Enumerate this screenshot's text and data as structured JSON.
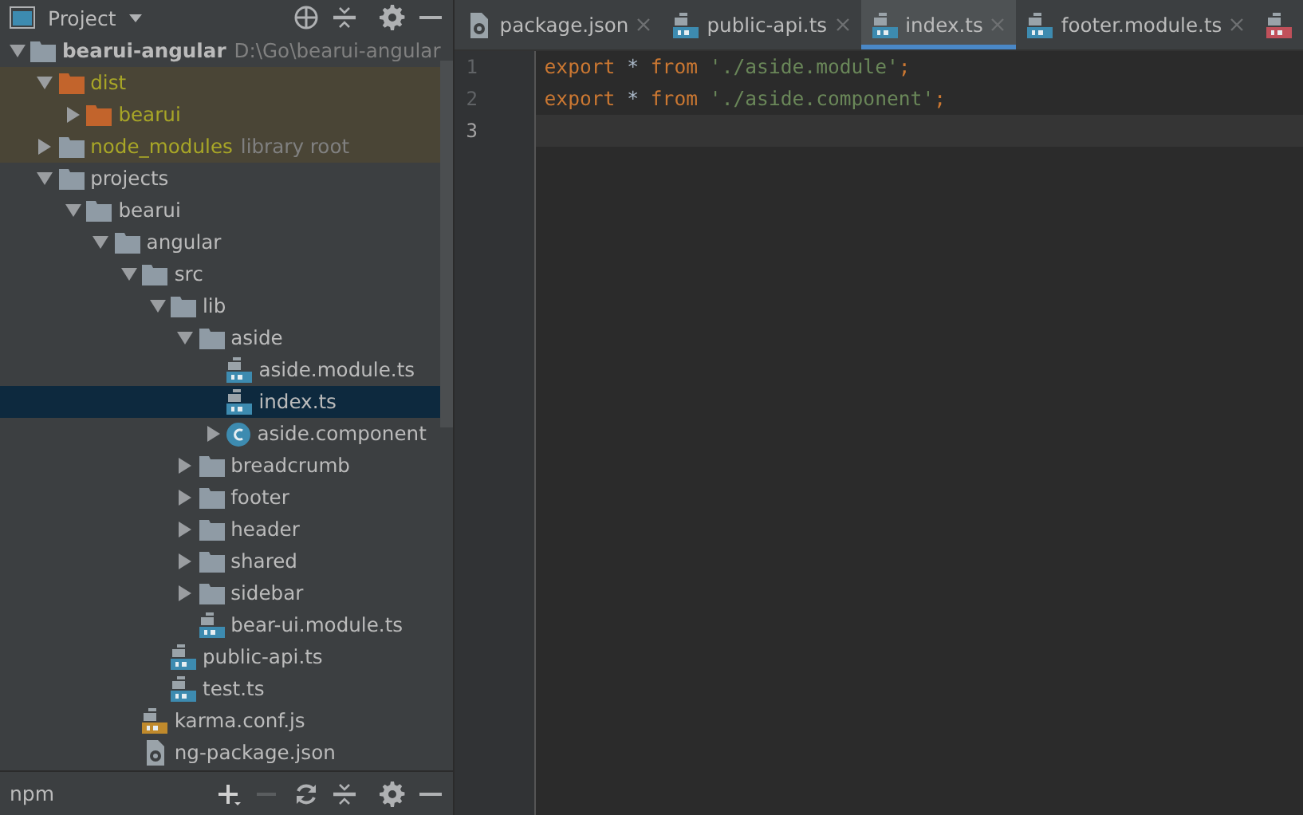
{
  "project_panel": {
    "title": "Project",
    "tree": [
      {
        "name": "bearui-angular",
        "kind": "folder",
        "expanded": true,
        "selected": false,
        "hint": "D:\\Go\\bearui-angular",
        "children": [
          {
            "name": "dist",
            "kind": "excluded_folder",
            "expanded": true,
            "selected": false,
            "children": [
              {
                "name": "bearui",
                "kind": "excluded_folder",
                "expanded": false,
                "selected": false
              }
            ]
          },
          {
            "name": "node_modules",
            "kind": "library_folder",
            "expanded": false,
            "selected": false,
            "hint": "library root"
          },
          {
            "name": "projects",
            "kind": "folder",
            "expanded": true,
            "selected": false,
            "children": [
              {
                "name": "bearui",
                "kind": "folder",
                "expanded": true,
                "selected": false,
                "children": [
                  {
                    "name": "angular",
                    "kind": "folder",
                    "expanded": true,
                    "selected": false,
                    "children": [
                      {
                        "name": "src",
                        "kind": "folder",
                        "expanded": true,
                        "selected": false,
                        "children": [
                          {
                            "name": "lib",
                            "kind": "folder",
                            "expanded": true,
                            "selected": false,
                            "children": [
                              {
                                "name": "aside",
                                "kind": "folder",
                                "expanded": true,
                                "selected": false,
                                "children": [
                                  {
                                    "name": "aside.module.ts",
                                    "kind": "ts",
                                    "selected": false
                                  },
                                  {
                                    "name": "index.ts",
                                    "kind": "ts",
                                    "selected": true
                                  },
                                  {
                                    "name": "aside.component",
                                    "kind": "component",
                                    "expanded": false,
                                    "selected": false
                                  }
                                ]
                              },
                              {
                                "name": "breadcrumb",
                                "kind": "folder",
                                "expanded": false,
                                "selected": false
                              },
                              {
                                "name": "footer",
                                "kind": "folder",
                                "expanded": false,
                                "selected": false
                              },
                              {
                                "name": "header",
                                "kind": "folder",
                                "expanded": false,
                                "selected": false
                              },
                              {
                                "name": "shared",
                                "kind": "folder",
                                "expanded": false,
                                "selected": false
                              },
                              {
                                "name": "sidebar",
                                "kind": "folder",
                                "expanded": false,
                                "selected": false
                              },
                              {
                                "name": "bear-ui.module.ts",
                                "kind": "ts",
                                "selected": false
                              }
                            ]
                          },
                          {
                            "name": "public-api.ts",
                            "kind": "ts",
                            "selected": false
                          },
                          {
                            "name": "test.ts",
                            "kind": "ts",
                            "selected": false
                          }
                        ]
                      },
                      {
                        "name": "karma.conf.js",
                        "kind": "js",
                        "selected": false
                      },
                      {
                        "name": "ng-package.json",
                        "kind": "json",
                        "selected": false
                      }
                    ]
                  }
                ]
              }
            ]
          }
        ]
      }
    ]
  },
  "npm_panel": {
    "title": "npm"
  },
  "editor": {
    "tabs": [
      {
        "label": "package.json",
        "kind": "json",
        "selected": false
      },
      {
        "label": "public-api.ts",
        "kind": "ts",
        "selected": false
      },
      {
        "label": "index.ts",
        "kind": "ts",
        "selected": true
      },
      {
        "label": "footer.module.ts",
        "kind": "ts",
        "selected": false
      },
      {
        "kind": "sass",
        "selected": false
      }
    ],
    "lines": [
      {
        "number": "1",
        "current": false,
        "tokens": [
          {
            "kind": "keyword",
            "text": "export"
          },
          {
            "kind": "plain",
            "text": " * "
          },
          {
            "kind": "keyword",
            "text": "from"
          },
          {
            "kind": "string",
            "text": " './aside.module'"
          },
          {
            "kind": "keyword",
            "text": ";"
          }
        ]
      },
      {
        "number": "2",
        "current": false,
        "tokens": [
          {
            "kind": "keyword",
            "text": "export"
          },
          {
            "kind": "plain",
            "text": " * "
          },
          {
            "kind": "keyword",
            "text": "from"
          },
          {
            "kind": "string",
            "text": " './aside.component'"
          },
          {
            "kind": "keyword",
            "text": ";"
          }
        ]
      },
      {
        "number": "3",
        "current": true
      }
    ]
  }
}
